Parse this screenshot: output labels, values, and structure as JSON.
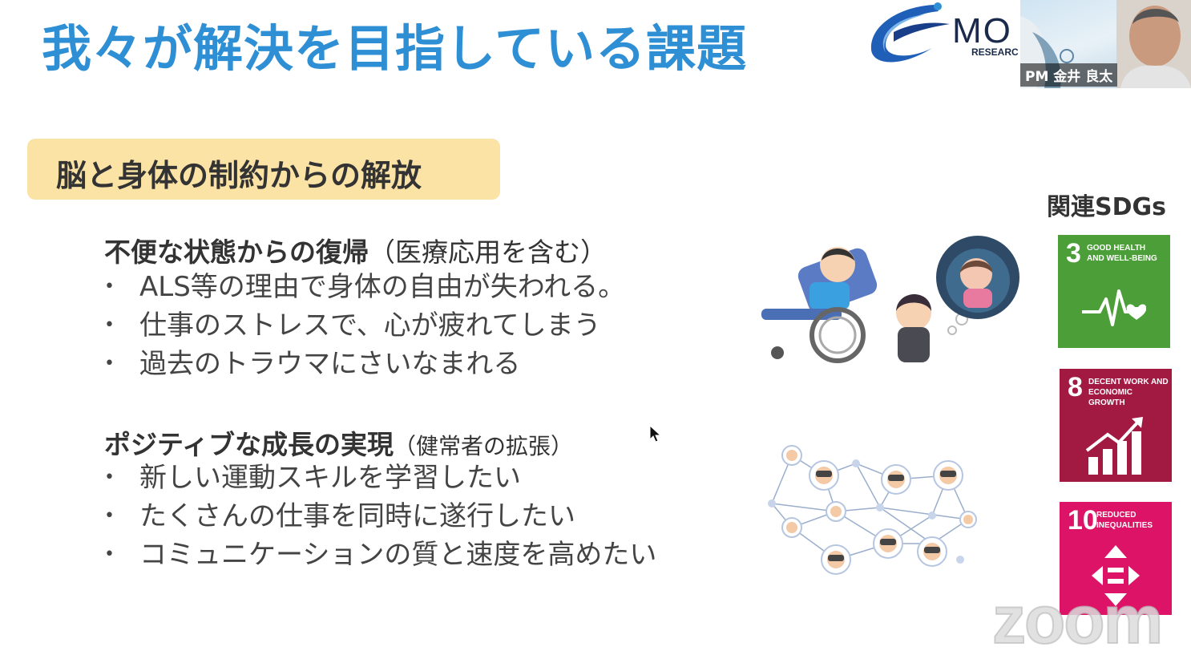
{
  "slide": {
    "title": "我々が解決を目指している課題",
    "section_title": "脳と身体の制約からの解放",
    "block1": {
      "heading": "不便な状態からの復帰",
      "note": "（医療応用を含む）",
      "items": [
        "ALS等の理由で身体の自由が失われる。",
        "仕事のストレスで、心が疲れてしまう",
        "過去のトラウマにさいなまれる"
      ]
    },
    "block2": {
      "heading": "ポジティブな成長の実現",
      "note": "（健常者の拡張）",
      "items": [
        "新しい運動スキルを学習したい",
        "たくさんの仕事を同時に遂行したい",
        "コミュニケーションの質と速度を高めたい"
      ]
    },
    "sdgs_label": "関連SDGs",
    "sdgs": [
      {
        "number": "3",
        "label_line1": "GOOD HEALTH",
        "label_line2": "AND WELL-BEING",
        "color": "#4c9f38",
        "icon": "heartbeat-icon"
      },
      {
        "number": "8",
        "label_line1": "DECENT WORK AND",
        "label_line2": "ECONOMIC GROWTH",
        "color": "#a21942",
        "icon": "growth-chart-icon"
      },
      {
        "number": "10",
        "label_line1": "REDUCED",
        "label_line2": "INEQUALITIES",
        "color": "#dd1367",
        "icon": "equality-icon"
      }
    ]
  },
  "logo": {
    "text": "MO",
    "sub": "RESEARC"
  },
  "video": {
    "participant": "PM 金井 良太"
  },
  "watermark": "zoom",
  "colors": {
    "title_blue": "#2e8fd4",
    "section_bg": "#fbe3a6"
  }
}
